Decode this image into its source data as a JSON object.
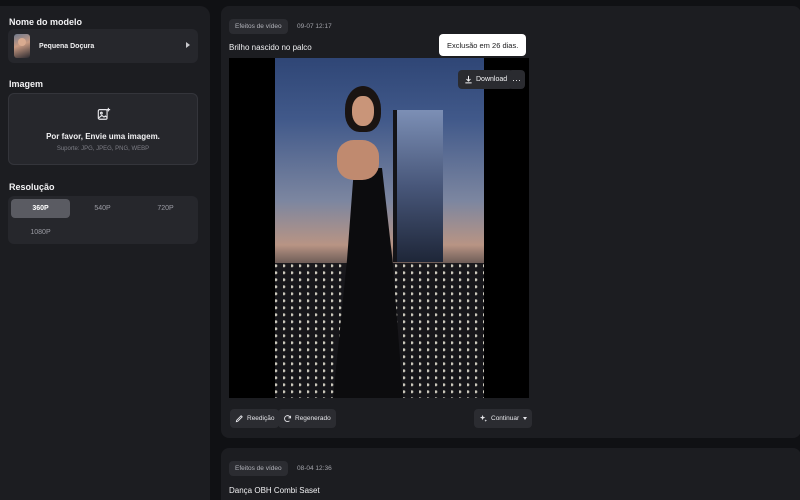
{
  "sidebar": {
    "model_label": "Nome do modelo",
    "model_name": "Pequena Doçura",
    "image_label": "Imagem",
    "upload_title": "Por favor, Envie uma imagem.",
    "upload_support": "Suporte: JPG, JPEG, PNG, WEBP",
    "resolution_label": "Resolução",
    "resolutions": [
      "360P",
      "540P",
      "720P",
      "1080P"
    ],
    "selected_resolution": "360P"
  },
  "cards": [
    {
      "tag": "Efeitos de vídeo",
      "time": "09-07 12:17",
      "title": "Brilho nascido no palco",
      "tooltip": "Exclusão em 26 dias.",
      "download_label": "Download",
      "more_label": "···",
      "actions": {
        "edit": "Reedição",
        "regenerate": "Regenerado",
        "continue": "Continuar"
      }
    },
    {
      "tag": "Efeitos de vídeo",
      "time": "08-04 12:36",
      "title": "Dança OBH Combi Saset"
    }
  ],
  "colors": {
    "background": "#101114",
    "panel": "#1c1d21",
    "control": "#26272c",
    "active_resolution": "#5a5b62",
    "tooltip_bg": "#ffffff"
  },
  "icons": {
    "upload": "image-plus-icon",
    "expand": "chevron-right-icon",
    "download": "download-icon",
    "more": "more-icon",
    "edit": "pencil-icon",
    "regenerate": "refresh-icon",
    "continue": "sparkle-icon",
    "dropdown": "caret-down-icon"
  }
}
